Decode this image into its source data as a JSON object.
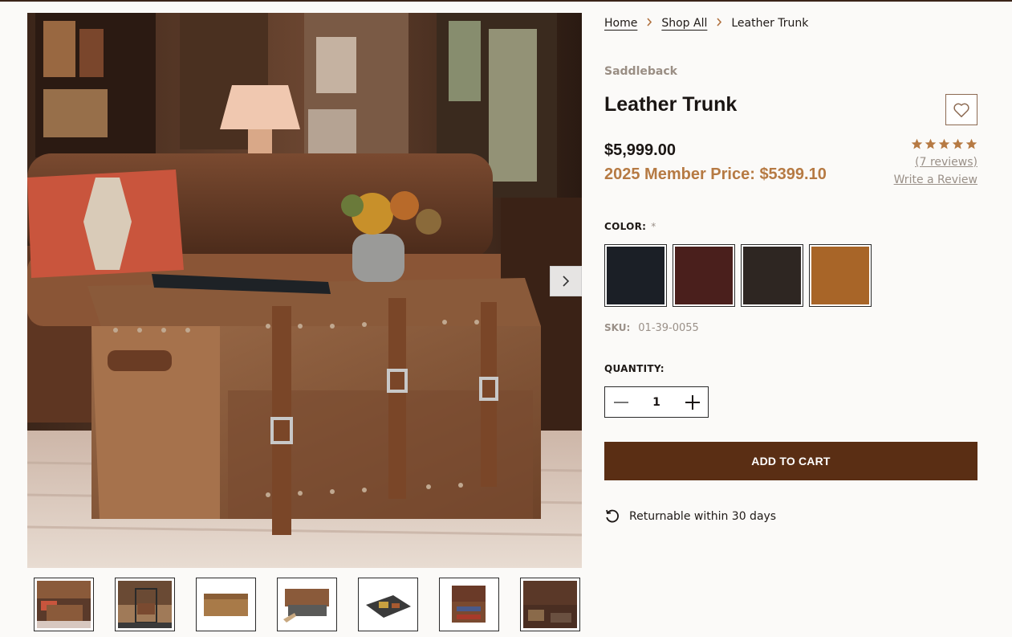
{
  "breadcrumb": [
    {
      "label": "Home"
    },
    {
      "label": "Shop All"
    },
    {
      "label": "Leather Trunk"
    }
  ],
  "product": {
    "brand": "Saddleback",
    "title": "Leather Trunk",
    "price": "$5,999.00",
    "member_price": "2025 Member Price: $5399.10",
    "rating": 5,
    "reviews_label": "(7 reviews)",
    "write_review_label": "Write a Review",
    "sku_label": "SKU:",
    "sku": "01-39-0055"
  },
  "color": {
    "label": "COLOR:",
    "required_marker": "*",
    "swatches": [
      {
        "name": "black",
        "hex": "#1b1f26"
      },
      {
        "name": "dark-chestnut",
        "hex": "#4a1f1c"
      },
      {
        "name": "dark-coffee-brown",
        "hex": "#2e2622"
      },
      {
        "name": "tobacco",
        "hex": "#a86528"
      }
    ]
  },
  "quantity": {
    "label": "QUANTITY:",
    "value": "1"
  },
  "add_to_cart_label": "ADD TO CART",
  "returnable_text": "Returnable within 30 days",
  "icons": {
    "wishlist": "heart-icon",
    "gallery_next": "chevron-right-icon",
    "breadcrumb_separator": "chevron-right-icon",
    "return": "return-arrow-icon",
    "decrease": "minus-icon",
    "increase": "plus-icon"
  },
  "colors": {
    "accent": "#b67a43",
    "button": "#5a2e14",
    "star": "#b67a43"
  }
}
